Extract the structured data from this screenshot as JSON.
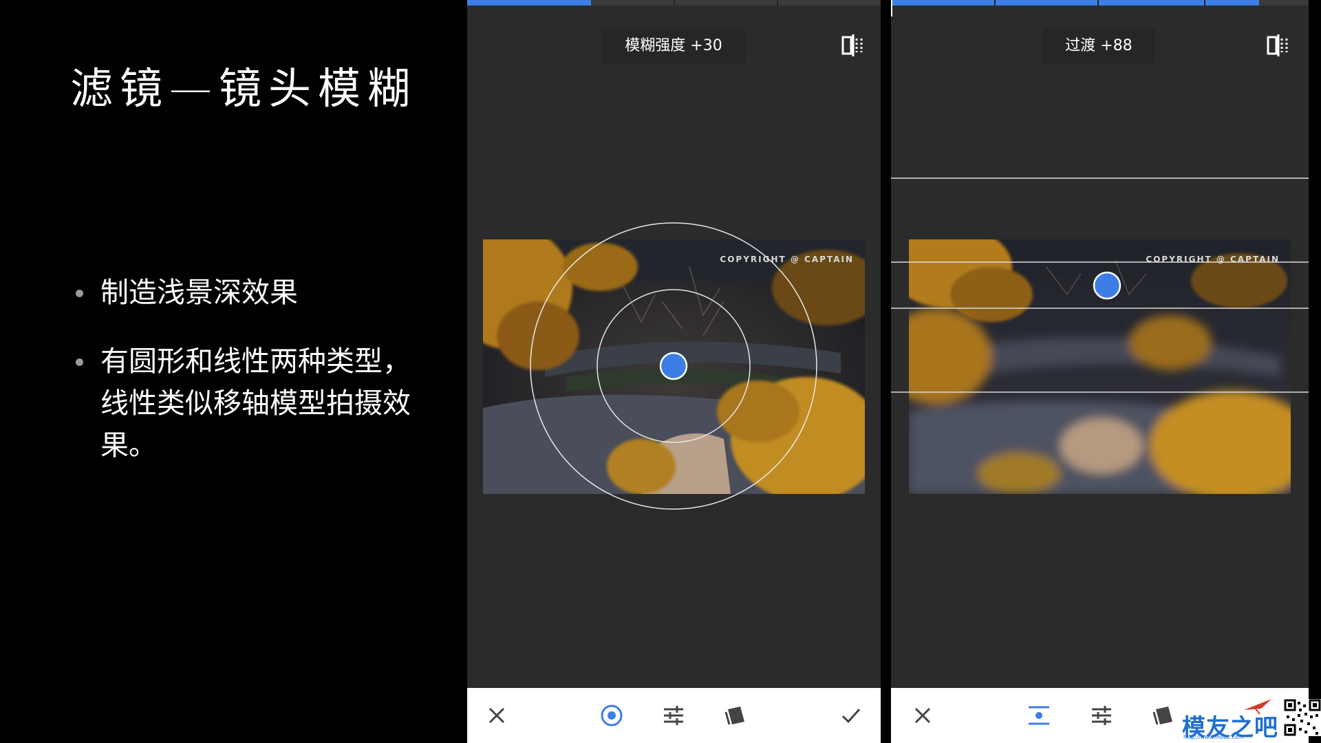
{
  "slide": {
    "title": "滤镜—镜头模糊",
    "bullets": [
      "制造浅景深效果",
      "有圆形和线性两种类型，线性类似移轴模型拍摄效果。"
    ]
  },
  "phone_left": {
    "param_label": "模糊强度 +30",
    "copyright": "COPYRIGHT @ CAPTAIN",
    "toolbar": [
      "close-icon",
      "radial-blur-icon",
      "adjust-sliders-icon",
      "styles-icon",
      "check-icon"
    ],
    "mode": "radial"
  },
  "phone_right": {
    "param_label": "过渡 +88",
    "copyright": "COPYRIGHT @ CAPTAIN",
    "toolbar": [
      "close-icon",
      "linear-blur-icon",
      "adjust-sliders-icon",
      "styles-icon"
    ],
    "mode": "linear"
  },
  "watermark": {
    "text": "模友之吧",
    "url": "http://www.moz8.com"
  },
  "colors": {
    "accent": "#3c7ee6",
    "app_bg": "#2b2b2b",
    "slide_bg": "#000000"
  }
}
